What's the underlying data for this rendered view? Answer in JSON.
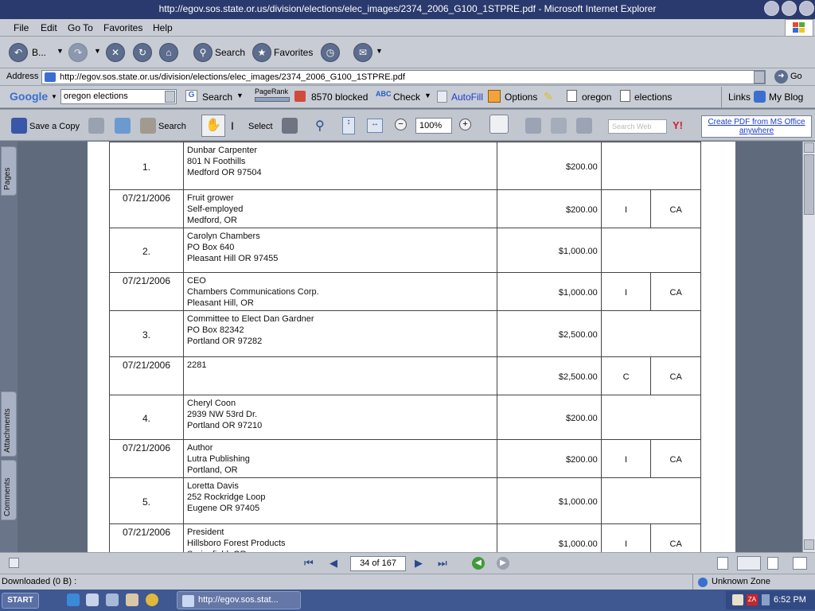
{
  "window": {
    "title": "http://egov.sos.state.or.us/division/elections/elec_images/2374_2006_G100_1STPRE.pdf - Microsoft Internet Explorer"
  },
  "menu": [
    "File",
    "Edit",
    "Go To",
    "Favorites",
    "Help"
  ],
  "nav": {
    "back": "B...",
    "search": "Search",
    "favorites": "Favorites"
  },
  "address": {
    "label": "Address",
    "url": "http://egov.sos.state.or.us/division/elections/elec_images/2374_2006_G100_1STPRE.pdf",
    "go": "Go"
  },
  "google": {
    "logo": "Google",
    "query": "oregon elections",
    "search": "Search",
    "pagerank": "PageRank",
    "blocked": "8570 blocked",
    "check": "Check",
    "autofill": "AutoFill",
    "options": "Options",
    "hl1": "oregon",
    "hl2": "elections",
    "links": "Links",
    "myblog": "My Blog"
  },
  "pdf": {
    "save": "Save a Copy",
    "search": "Search",
    "select": "Select",
    "zoom": "100%",
    "search_web": "Search Web",
    "create_pdf_line1": "Create PDF from MS Office",
    "create_pdf_line2": "anywhere"
  },
  "sidebar": {
    "tabs": [
      "Pages",
      "Attachments",
      "Comments"
    ]
  },
  "table_rows": [
    {
      "type": "num",
      "c0": "1.",
      "lines": [
        "Dunbar Carpenter",
        "801 N Foothills",
        "Medford OR 97504"
      ],
      "amount": "$200.00",
      "c3": "",
      "c4": ""
    },
    {
      "type": "date",
      "c0": "07/21/2006",
      "lines": [
        "Fruit grower",
        "Self-employed",
        "Medford, OR"
      ],
      "amount": "$200.00",
      "c3": "I",
      "c4": "CA"
    },
    {
      "type": "num",
      "c0": "2.",
      "lines": [
        "Carolyn Chambers",
        "PO Box 640",
        "Pleasant Hill OR 97455"
      ],
      "amount": "$1,000.00",
      "c3": "",
      "c4": ""
    },
    {
      "type": "date",
      "c0": "07/21/2006",
      "lines": [
        "CEO",
        "Chambers Communications Corp.",
        "Pleasant Hill, OR"
      ],
      "amount": "$1,000.00",
      "c3": "I",
      "c4": "CA"
    },
    {
      "type": "num",
      "c0": "3.",
      "lines": [
        "Committee to Elect Dan Gardner",
        "PO Box 82342",
        "Portland OR 97282"
      ],
      "amount": "$2,500.00",
      "c3": "",
      "c4": ""
    },
    {
      "type": "date",
      "c0": "07/21/2006",
      "lines": [
        "2281"
      ],
      "amount": "$2,500.00",
      "c3": "C",
      "c4": "CA"
    },
    {
      "type": "num",
      "c0": "4.",
      "lines": [
        "Cheryl Coon",
        "2939 NW 53rd Dr.",
        "Portland OR 97210"
      ],
      "amount": "$200.00",
      "c3": "",
      "c4": ""
    },
    {
      "type": "date",
      "c0": "07/21/2006",
      "lines": [
        "Author",
        "Lutra Publishing",
        "Portland, OR"
      ],
      "amount": "$200.00",
      "c3": "I",
      "c4": "CA"
    },
    {
      "type": "num",
      "c0": "5.",
      "lines": [
        "Loretta Davis",
        "252 Rockridge Loop",
        "Eugene OR 97405"
      ],
      "amount": "$1,000.00",
      "c3": "",
      "c4": ""
    },
    {
      "type": "date",
      "c0": "07/21/2006",
      "lines": [
        "President",
        "Hillsboro Forest Products",
        "Springfield, OR"
      ],
      "amount": "$1,000.00",
      "c3": "I",
      "c4": "CA"
    }
  ],
  "pagenav": {
    "page": "34 of 167"
  },
  "status": {
    "text": "Downloaded  (0 B) :",
    "zone": "Unknown Zone"
  },
  "taskbar": {
    "start": "START",
    "task": "http://egov.sos.stat...",
    "time": "6:52 PM"
  },
  "colors": {
    "titlebar": "#2a3a6e",
    "toolbar": "#c4c8d0",
    "taskbar": "#3f5892",
    "doc_bg": "#5f6b7d"
  }
}
